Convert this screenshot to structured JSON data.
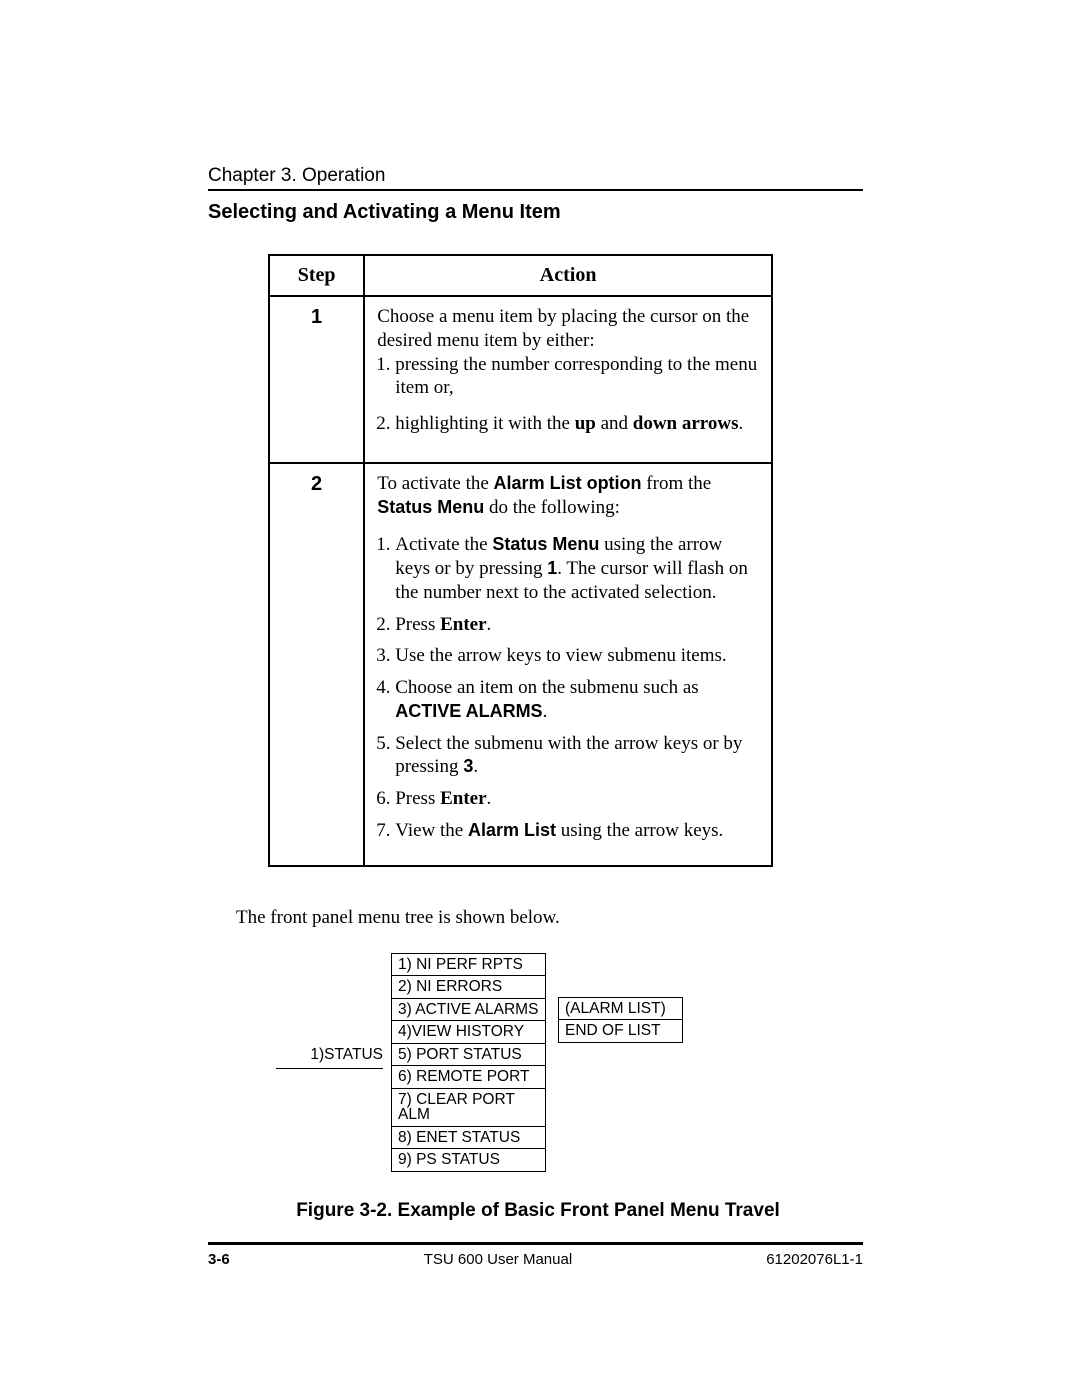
{
  "header": {
    "chapter": "Chapter 3.  Operation"
  },
  "section": {
    "title": "Selecting and Activating a Menu Item"
  },
  "table": {
    "head": {
      "step": "Step",
      "action": "Action"
    },
    "rows": [
      {
        "num": "1",
        "intro": "Choose a menu item by placing the cursor on the desired menu item by either:",
        "item1": "pressing the number corresponding to the menu item or,",
        "item2_pre": "highlighting it with the ",
        "item2_b1": "up",
        "item2_mid": " and ",
        "item2_b2": "down arrows",
        "item2_post": "."
      },
      {
        "num": "2",
        "intro_a": "To activate the ",
        "intro_b": "Alarm List option",
        "intro_c": " from the ",
        "intro_d": "Status Menu",
        "intro_e": " do the following:",
        "li1_a": "Activate the ",
        "li1_b": "Status Menu",
        "li1_c": " using the arrow keys or by pressing ",
        "li1_d": "1",
        "li1_e": ". The cursor will flash on the number next to the activated selection.",
        "li2_a": "Press ",
        "li2_b": "Enter",
        "li2_c": ".",
        "li3": "Use the arrow keys to view submenu items.",
        "li4_a": "Choose an item on the submenu such as ",
        "li4_b": "ACTIVE ALARMS",
        "li4_c": ".",
        "li5_a": "Select the submenu with the arrow keys or by pressing ",
        "li5_b": "3",
        "li5_c": ".",
        "li6_a": "Press ",
        "li6_b": "Enter",
        "li6_c": ".",
        "li7_a": "View the ",
        "li7_b": "Alarm List",
        "li7_c": " using the arrow keys."
      }
    ]
  },
  "body": {
    "text": "The front panel menu tree is shown below."
  },
  "tree": {
    "left": "1)STATUS",
    "middle": [
      "1) NI PERF RPTS",
      "2) NI ERRORS",
      "3) ACTIVE ALARMS",
      "4)VIEW HISTORY",
      "5) PORT STATUS",
      "6) REMOTE PORT",
      "7) CLEAR PORT ALM",
      "8) ENET STATUS",
      "9) PS STATUS"
    ],
    "right": [
      "(ALARM LIST)",
      "END OF LIST"
    ]
  },
  "figure": {
    "caption": "Figure 3-2.  Example of Basic Front Panel Menu Travel"
  },
  "footer": {
    "page": "3-6",
    "title": "TSU 600 User Manual",
    "doc": "61202076L1-1"
  }
}
